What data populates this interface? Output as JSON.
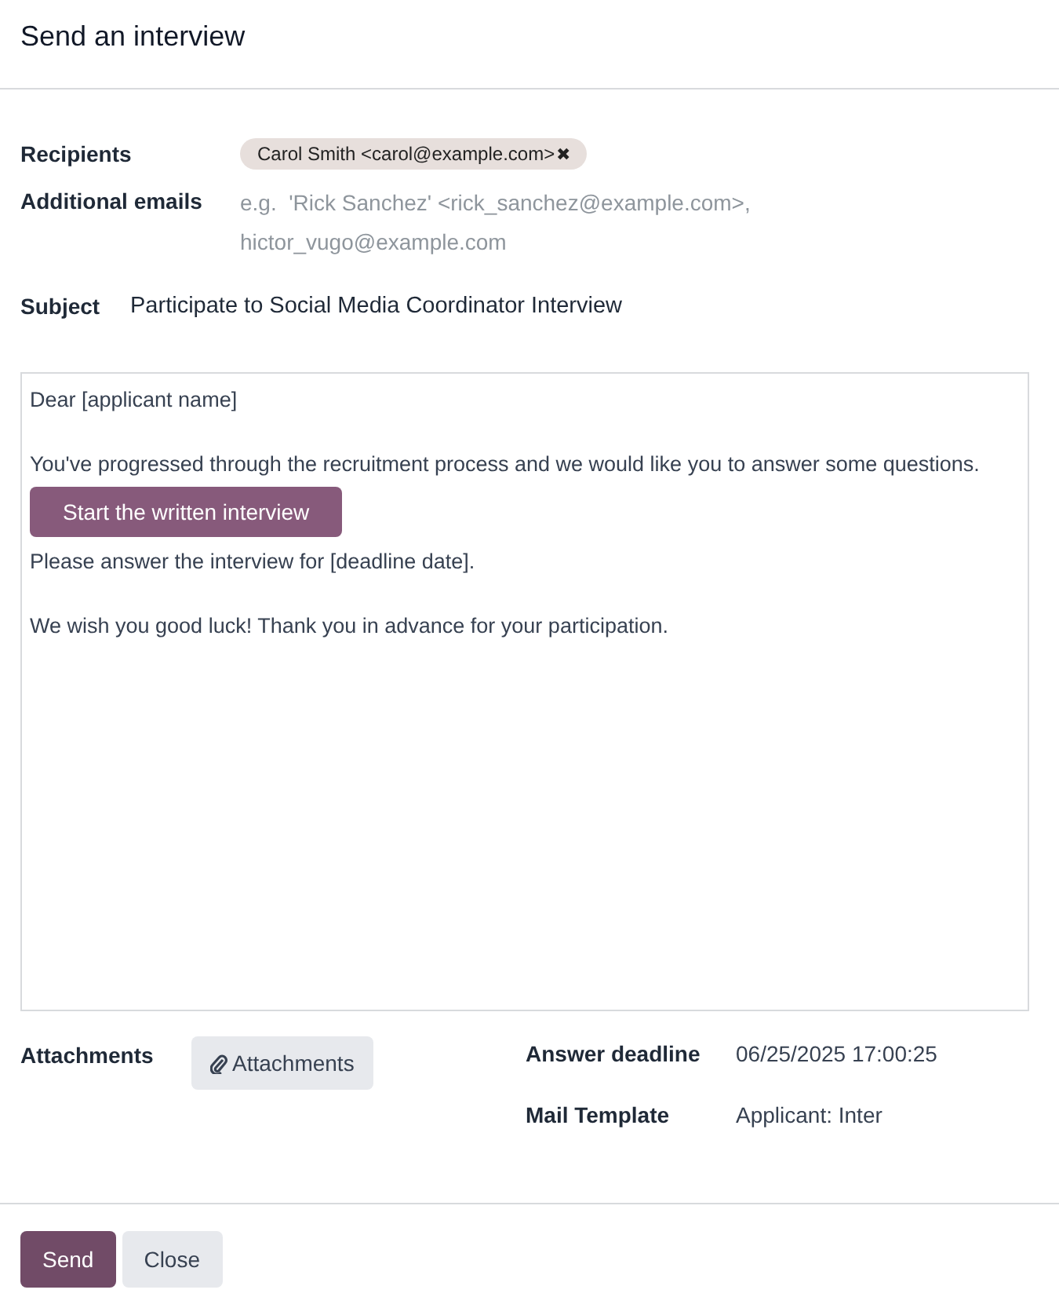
{
  "dialog": {
    "title": "Send an interview"
  },
  "recipients": {
    "label": "Recipients",
    "tags": [
      {
        "text": "Carol Smith <carol@example.com>",
        "remove": "✖"
      }
    ]
  },
  "additional_emails": {
    "label": "Additional emails",
    "placeholder": "e.g.  'Rick Sanchez' <rick_sanchez@example.com>, hictor_vugo@example.com"
  },
  "subject": {
    "label": "Subject",
    "value": "Participate to Social Media Coordinator Interview"
  },
  "body": [
    {
      "kind": "text",
      "text": "Dear [applicant name]"
    },
    {
      "kind": "blank"
    },
    {
      "kind": "text",
      "text": "You've progressed through the recruitment process and we would like you to answer some questions."
    },
    {
      "kind": "button",
      "text": "Start the written interview"
    },
    {
      "kind": "text",
      "text": "Please answer the interview for [deadline date]."
    },
    {
      "kind": "blank"
    },
    {
      "kind": "text",
      "text": "We wish you good luck! Thank you in advance for your participation."
    }
  ],
  "attachments": {
    "label": "Attachments",
    "button": "Attachments"
  },
  "answer_deadline": {
    "label": "Answer deadline",
    "value": "06/25/2025 17:00:25"
  },
  "mail_template": {
    "label": "Mail Template",
    "value": "Applicant: Inter"
  },
  "buttons": [
    {
      "kind": "primary",
      "label": "Send"
    },
    {
      "kind": "secondary",
      "label": "Close"
    }
  ]
}
